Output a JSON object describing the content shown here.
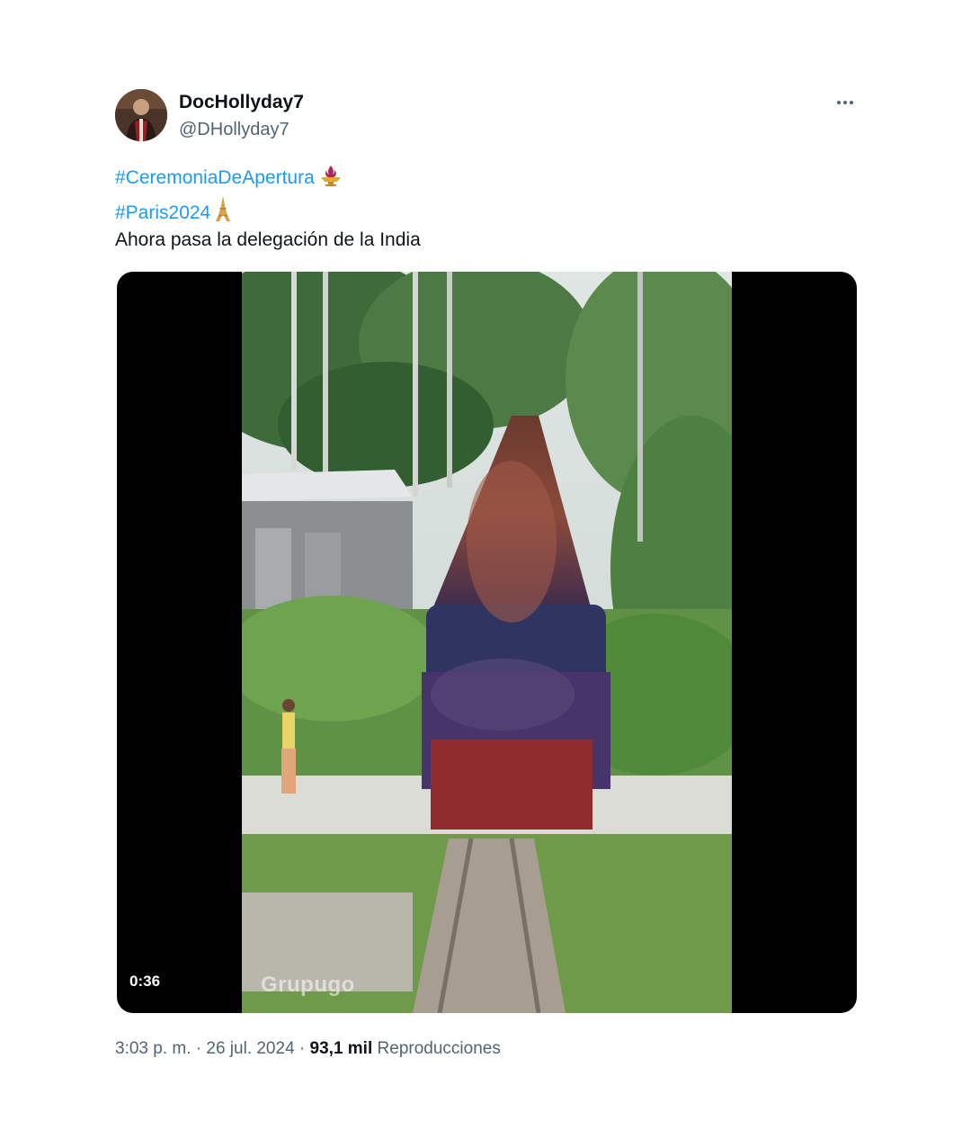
{
  "author": {
    "display_name": "DocHollyday7",
    "handle": "@DHollyday7"
  },
  "tweet": {
    "hashtag_1": "#CeremoniaDeApertura",
    "hashtag_1_emoji": "olympic-torch-icon",
    "hashtag_2": "#Paris2024",
    "hashtag_2_emoji": "eiffel-tower-icon",
    "text": "Ahora pasa la delegación de la India"
  },
  "media": {
    "type": "video",
    "duration": "0:36",
    "watermark": "Grupugo"
  },
  "meta": {
    "time": "3:03 p. m.",
    "separator": " · ",
    "date": "26 jul. 2024",
    "views_count": "93,1 mil",
    "views_label": "Reproducciones"
  },
  "colors": {
    "link": "#1d9bf0",
    "text": "#0f1419",
    "muted": "#536471",
    "media_bg": "#000000"
  }
}
